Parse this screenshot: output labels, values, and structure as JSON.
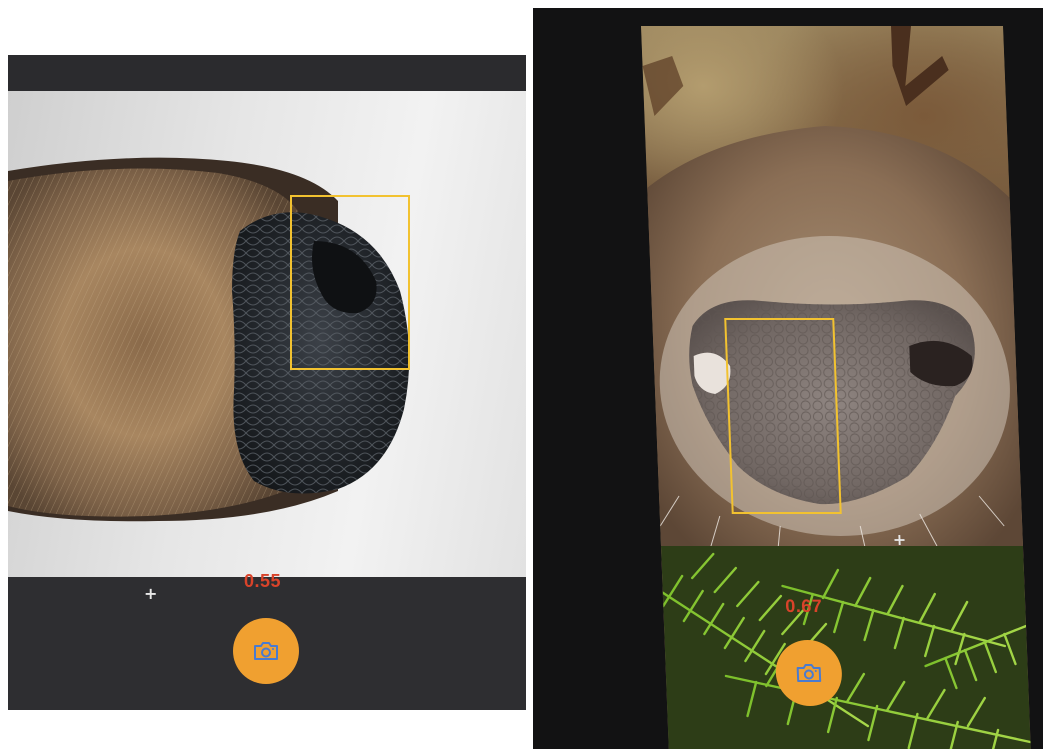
{
  "left_screen": {
    "similarity_score": "0.55",
    "crosshair": "+",
    "capture_icon": "camera-icon",
    "photo_subject": "deer-muzzle"
  },
  "right_screen": {
    "similarity_score": "0.67",
    "crosshair": "+",
    "capture_icon": "camera-icon",
    "photo_subject": "deer-muzzle"
  },
  "colors": {
    "detection_box": "#f2c230",
    "capture_button": "#f0a030",
    "score_text": "#d9432a",
    "camera_glyph": "#4a7bd0"
  }
}
